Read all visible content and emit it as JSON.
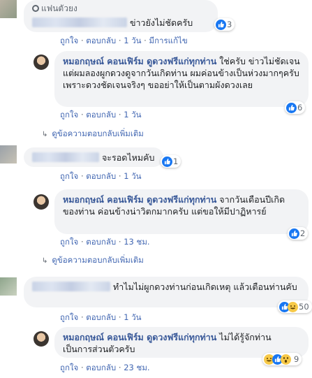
{
  "comment1": {
    "name": "แฟนตัวยง",
    "text": "ข่าวยังไม่ชัดครับ",
    "like_count": "3",
    "action_like": "ถูกใจ",
    "action_reply": "ตอบกลับ",
    "time": "1 วัน",
    "edited": "มีการแก้ไข"
  },
  "reply1": {
    "name": "หมอกฤษณ์ คอนเฟิร์ม ดูดวงฟรีแก่ทุกท่าน",
    "text": "ใช่ครับ ข่าวไม่ชัดเจน แต่ผมลองผูกดวงดูจากวันเกิดท่าน ผมค่อนข้างเป็นห่วงมากๆครับ เพราะดวงชัดเจนจริงๆ ขออย่าให้เป็นตามผังดวงเลย",
    "like_count": "6",
    "action_like": "ถูกใจ",
    "action_reply": "ตอบกลับ",
    "time": "1 วัน"
  },
  "more_replies_1": "ดูข้อความตอบกลับเพิ่มเติม",
  "comment2": {
    "text": "จะรอดไหมคับ",
    "like_count": "1",
    "action_like": "ถูกใจ",
    "action_reply": "ตอบกลับ",
    "time": "1 วัน"
  },
  "reply2": {
    "name": "หมอกฤษณ์ คอนเฟิร์ม ดูดวงฟรีแก่ทุกท่าน",
    "text": "จากวันเดือนปีเกิดของท่าน ค่อนข้างน่าวิตกมากครับ แต่ขอให้มีปาฏิหารย์",
    "like_count": "2",
    "action_like": "ถูกใจ",
    "action_reply": "ตอบกลับ",
    "time": "13 ชม."
  },
  "more_replies_2": "ดูข้อความตอบกลับเพิ่มเติม",
  "comment3": {
    "text": "ทำไมไม่ผูกดวงท่านก่อนเกิดเหตุ แล้วเตือนท่านคับ",
    "reaction_count": "50",
    "action_like": "ถูกใจ",
    "action_reply": "ตอบกลับ",
    "time": "1 วัน"
  },
  "reply3": {
    "name": "หมอกฤษณ์ คอนเฟิร์ม ดูดวงฟรีแก่ทุกท่าน",
    "text": "ไม่ได้รู้จักท่านเป็นการส่วนตัวครับ",
    "reaction_count": "9",
    "action_like": "ถูกใจ",
    "action_reply": "ตอบกลับ",
    "time": "23 ชม."
  },
  "separator": "·",
  "colors": {
    "link": "#385898",
    "bubble": "#f2f3f5",
    "like": "#1877f2"
  }
}
